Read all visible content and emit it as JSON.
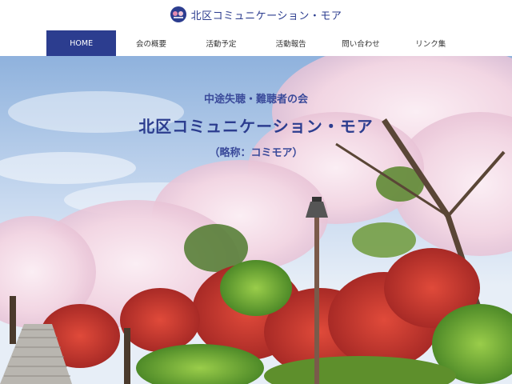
{
  "brand": {
    "title": "北区コミュニケーション・モア",
    "logo_icon": "circle-logo-icon",
    "primary_color": "#2c3d8f"
  },
  "nav": {
    "items": [
      {
        "label": "HOME",
        "active": true
      },
      {
        "label": "会の概要"
      },
      {
        "label": "活動予定"
      },
      {
        "label": "活動報告"
      },
      {
        "label": "問い合わせ"
      },
      {
        "label": "リンク集"
      }
    ]
  },
  "hero": {
    "subtitle": "中途失聴・難聴者の会",
    "title": "北区コミュニケーション・モア",
    "abbreviation": "（略称：コミモア）"
  }
}
